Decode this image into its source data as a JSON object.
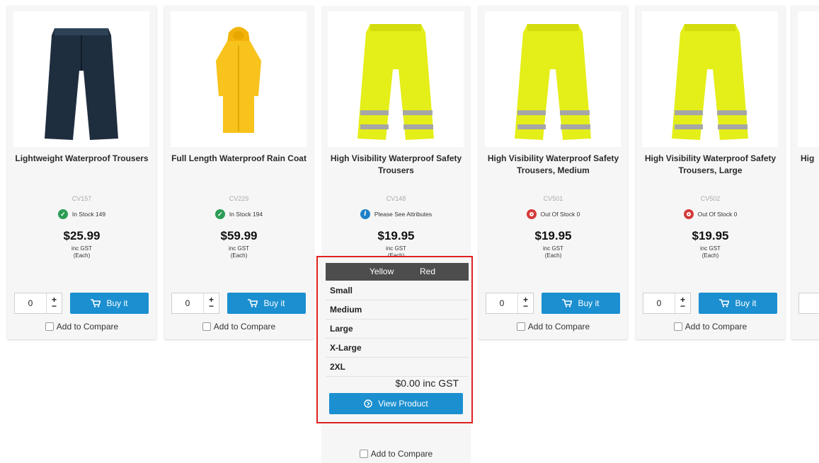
{
  "products": [
    {
      "name": "Lightweight Waterproof Trousers",
      "sku": "CV157",
      "stock": "In Stock 149",
      "price": "$25.99",
      "tax": "inc GST",
      "unit": "(Each)",
      "qty": "0",
      "buy": "Buy it",
      "compare": "Add to Compare"
    },
    {
      "name": "Full Length Waterproof Rain Coat",
      "sku": "CV229",
      "stock": "In Stock 194",
      "price": "$59.99",
      "tax": "inc GST",
      "unit": "(Each)",
      "qty": "0",
      "buy": "Buy it",
      "compare": "Add to Compare"
    },
    {
      "name": "High Visibility Waterproof Safety Trousers",
      "sku": "CV148",
      "stock": "Please See Attributes",
      "price": "$19.95",
      "tax": "inc GST",
      "unit": "(Each)",
      "compare": "Add to Compare"
    },
    {
      "name": "High Visibility Waterproof Safety Trousers, Medium",
      "sku": "CV501",
      "stock": "Out Of Stock 0",
      "price": "$19.95",
      "tax": "inc GST",
      "unit": "(Each)",
      "qty": "0",
      "buy": "Buy it",
      "compare": "Add to Compare"
    },
    {
      "name": "High Visibility Waterproof Safety Trousers, Large",
      "sku": "CV502",
      "stock": "Out Of Stock 0",
      "price": "$19.95",
      "tax": "inc GST",
      "unit": "(Each)",
      "qty": "0",
      "buy": "Buy it",
      "compare": "Add to Compare"
    },
    {
      "name": "Hig"
    }
  ],
  "popup": {
    "colors": [
      "Yellow",
      "Red"
    ],
    "sizes": [
      "Small",
      "Medium",
      "Large",
      "X-Large",
      "2XL"
    ],
    "total": "$0.00 inc GST",
    "view_button": "View Product"
  },
  "icons": {
    "in_stock": "check-circle-icon",
    "attributes": "info-circle-icon",
    "out_of_stock": "out-of-stock-icon",
    "cart": "cart-icon",
    "view": "circle-arrow-icon"
  },
  "colors": {
    "accent": "#1b8fd0",
    "highlight": "#e02020",
    "in_stock": "#2a9d55",
    "out_stock": "#d63a3a"
  }
}
